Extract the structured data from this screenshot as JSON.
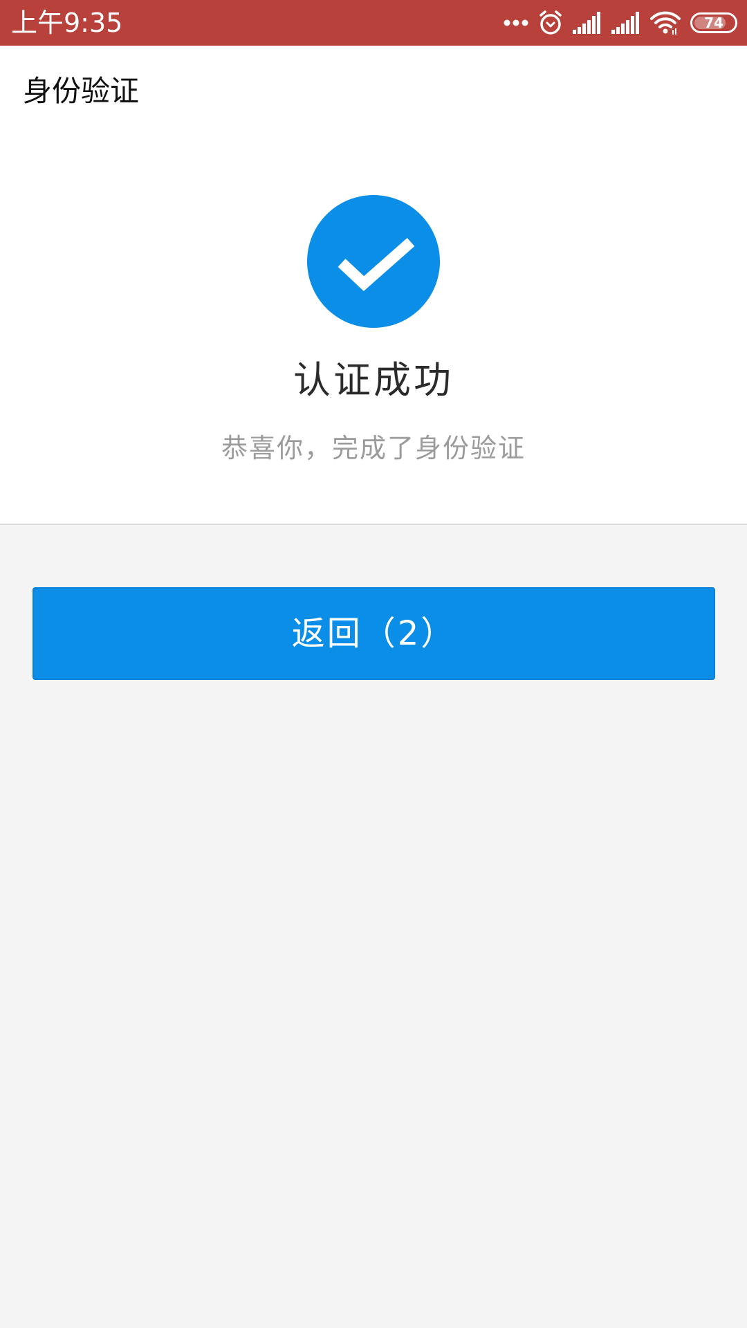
{
  "status_bar": {
    "time": "上午9:35",
    "battery_level": "74",
    "background_color": "#b8413b",
    "icons": [
      "more-dots-icon",
      "alarm-icon",
      "signal-icon",
      "signal-icon",
      "wifi-icon",
      "battery-icon"
    ]
  },
  "header": {
    "title": "身份验证"
  },
  "result": {
    "icon": "check-circle-icon",
    "title": "认证成功",
    "subtitle": "恭喜你，完成了身份验证",
    "accent_color": "#0a8ee8"
  },
  "actions": {
    "back_label": "返回（2）"
  }
}
